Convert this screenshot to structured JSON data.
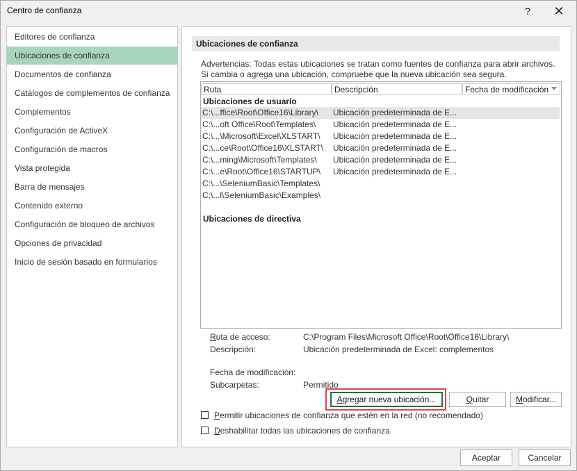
{
  "window": {
    "title": "Centro de confianza",
    "help_icon": "?",
    "close_icon": "✕"
  },
  "sidebar": {
    "items": [
      {
        "label": "Editores de confianza",
        "selected": false
      },
      {
        "label": "Ubicaciones de confianza",
        "selected": true
      },
      {
        "label": "Documentos de confianza",
        "selected": false
      },
      {
        "label": "Catálogos de complementos de confianza",
        "selected": false
      },
      {
        "label": "Complementos",
        "selected": false
      },
      {
        "label": "Configuración de ActiveX",
        "selected": false
      },
      {
        "label": "Configuración de macros",
        "selected": false
      },
      {
        "label": "Vista protegida",
        "selected": false
      },
      {
        "label": "Barra de mensajes",
        "selected": false
      },
      {
        "label": "Contenido externo",
        "selected": false
      },
      {
        "label": "Configuración de bloqueo de archivos",
        "selected": false
      },
      {
        "label": "Opciones de privacidad",
        "selected": false
      },
      {
        "label": "Inicio de sesión basado en formularios",
        "selected": false
      }
    ]
  },
  "main": {
    "section_title": "Ubicaciones de confianza",
    "warning": "Advertencias: Todas estas ubicaciones se tratan como fuentes de confianza para abrir archivos. Si cambia o agrega una ubicación, compruebe que la nueva ubicación sea segura.",
    "columns": [
      "Ruta",
      "Descripción",
      "Fecha de modificación"
    ],
    "user_group_label": "Ubicaciones de usuario",
    "policy_group_label": "Ubicaciones de directiva",
    "rows": [
      {
        "path": "C:\\...ffice\\Root\\Office16\\Library\\",
        "description": "Ubicación predeterminada de E...",
        "selected": true
      },
      {
        "path": "C:\\...oft Office\\Root\\Templates\\",
        "description": "Ubicación predeterminada de E...",
        "selected": false
      },
      {
        "path": "C:\\...\\Microsoft\\Excel\\XLSTART\\",
        "description": "Ubicación predeterminada de E...",
        "selected": false
      },
      {
        "path": "C:\\...ce\\Root\\Office16\\XLSTART\\",
        "description": "Ubicación predeterminada de E...",
        "selected": false
      },
      {
        "path": "C:\\...ming\\Microsoft\\Templates\\",
        "description": "Ubicación predeterminada de E...",
        "selected": false
      },
      {
        "path": "C:\\...e\\Root\\Office16\\STARTUP\\",
        "description": "Ubicación predeterminada de E...",
        "selected": false
      },
      {
        "path": "C:\\...\\SeleniumBasic\\Templates\\",
        "description": "",
        "selected": false
      },
      {
        "path": "C:\\...l\\SeleniumBasic\\Examples\\",
        "description": "",
        "selected": false
      }
    ],
    "details": {
      "path_label": "Ruta de acceso:",
      "path_value": "C:\\Program Files\\Microsoft Office\\Root\\Office16\\Library\\",
      "desc_label": "Descripción:",
      "desc_value": "Ubicación predeterminada de Excel: complementos",
      "date_label": "Fecha de modificación:",
      "date_value": "",
      "sub_label": "Subcarpetas:",
      "sub_value": "Permitido"
    },
    "buttons": {
      "add": "Agregar nueva ubicación...",
      "remove": "Quitar",
      "modify": "Modificar..."
    },
    "checkboxes": {
      "network": "Permitir ubicaciones de confianza que estén en la red (no recomendado)",
      "disable": "Deshabilitar todas las ubicaciones de confianza"
    }
  },
  "footer": {
    "ok": "Aceptar",
    "cancel": "Cancelar"
  }
}
